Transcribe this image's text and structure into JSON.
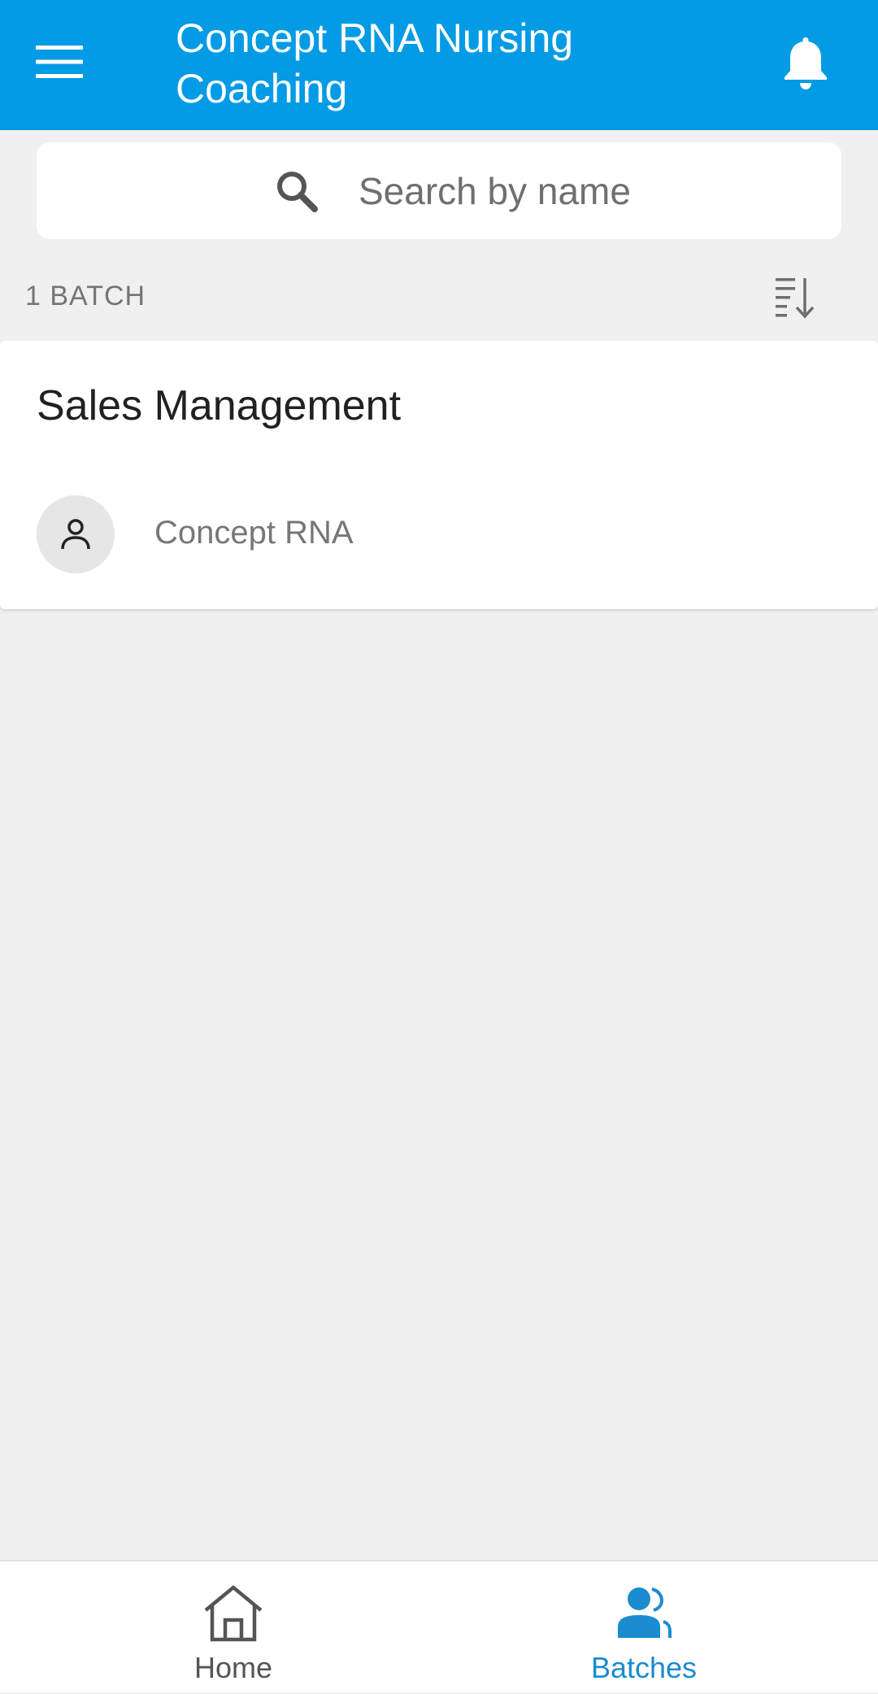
{
  "app_bar": {
    "title": "Concept RNA Nursing Coaching",
    "menu_icon": "hamburger-menu-icon",
    "notification_icon": "bell-icon"
  },
  "search": {
    "placeholder": "Search by name",
    "value": "",
    "icon": "search-icon"
  },
  "list_header": {
    "count_label": "1 BATCH",
    "sort_icon": "sort-descending-icon"
  },
  "batches": [
    {
      "title": "Sales Management",
      "owner": "Concept RNA",
      "avatar_icon": "person-icon"
    }
  ],
  "bottom_nav": {
    "items": [
      {
        "label": "Home",
        "icon": "home-icon",
        "active": false
      },
      {
        "label": "Batches",
        "icon": "batches-icon",
        "active": true
      }
    ]
  },
  "colors": {
    "primary": "#039be5",
    "active_nav": "#1a8ccf",
    "background": "#f0f0f0"
  }
}
